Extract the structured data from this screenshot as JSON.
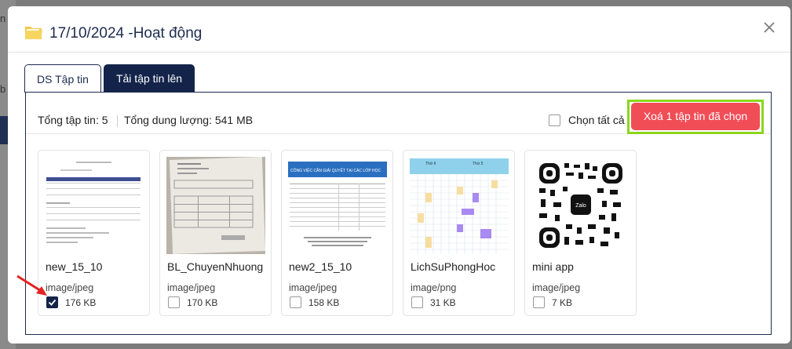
{
  "background": {
    "letter_1": "n",
    "letter_2": "b"
  },
  "dialog": {
    "title": "17/10/2024 -Hoạt động",
    "tabs": [
      {
        "label": "DS Tập tin",
        "active": true
      },
      {
        "label": "Tải tập tin lên",
        "active": false
      }
    ],
    "toolbar": {
      "total_files": "Tổng tập tin: 5",
      "total_size": "Tổng dung lượng: 541 MB",
      "select_all_label": "Chọn tất cả",
      "delete_label": "Xoá 1 tập tin đã chọn"
    },
    "files": [
      {
        "name": "new_15_10",
        "type": "image/jpeg",
        "size": "176 KB",
        "checked": true
      },
      {
        "name": "BL_ChuyenNhuong",
        "type": "image/jpeg",
        "size": "170 KB",
        "checked": false
      },
      {
        "name": "new2_15_10",
        "type": "image/jpeg",
        "size": "158 KB",
        "checked": false
      },
      {
        "name": "LichSuPhongHoc",
        "type": "image/png",
        "size": "31 KB",
        "checked": false
      },
      {
        "name": "mini app",
        "type": "image/jpeg",
        "size": "7 KB",
        "checked": false
      }
    ],
    "thumbnails": {
      "doc2_heading": "CÔNG VIỆC CẦN GIẢI QUYẾT TẠI CÁC LỚP HỌC",
      "schedule_day1": "Thứ 6",
      "schedule_day2": "Thứ 5",
      "qr_center": "Zalo"
    }
  },
  "colors": {
    "accent": "#13234a",
    "danger": "#f14d57",
    "highlight": "#8cd61c"
  }
}
